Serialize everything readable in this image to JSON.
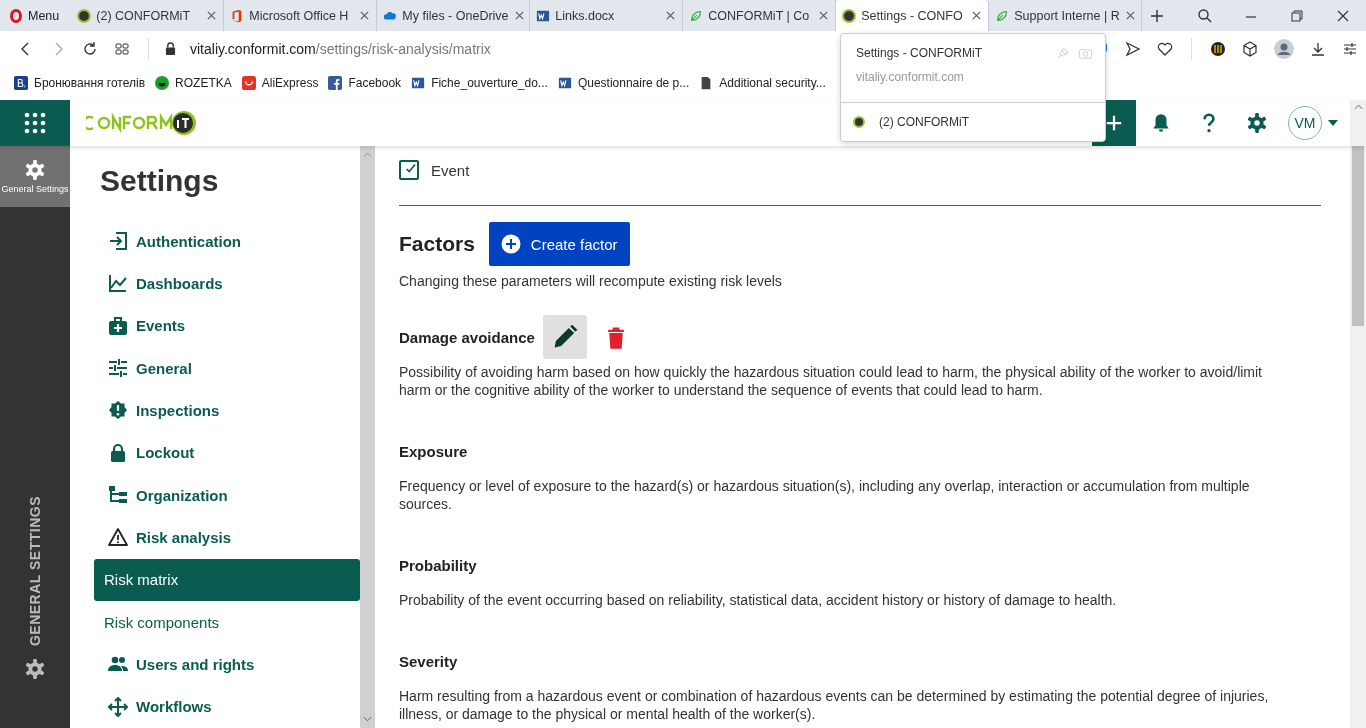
{
  "browser": {
    "menu": "Menu",
    "tabs": [
      {
        "title": "(2) CONFORMiT",
        "kind": "conformit",
        "selected": false
      },
      {
        "title": "Microsoft Office H",
        "kind": "office",
        "selected": false
      },
      {
        "title": "My files - OneDrive",
        "kind": "onedrive",
        "selected": false
      },
      {
        "title": "Links.docx",
        "kind": "word",
        "selected": false
      },
      {
        "title": "CONFORMiT | Co",
        "kind": "leaf",
        "selected": false
      },
      {
        "title": "Settings - CONFO",
        "kind": "conformit",
        "selected": true
      },
      {
        "title": "Support Interne | R",
        "kind": "leaf",
        "selected": false
      }
    ],
    "address": {
      "host": "vitaliy.conformit.com",
      "path": "/settings/risk-analysis/matrix"
    },
    "bookmarks": [
      {
        "label": "Бронювання готелів",
        "kind": "booking"
      },
      {
        "label": "ROZETKA",
        "kind": "rozetka"
      },
      {
        "label": "AliExpress",
        "kind": "ali"
      },
      {
        "label": "Facebook",
        "kind": "facebook"
      },
      {
        "label": "Fiche_ouverture_do...",
        "kind": "word"
      },
      {
        "label": "Questionnaire de p...",
        "kind": "word"
      },
      {
        "label": "Additional security...",
        "kind": "file"
      }
    ],
    "tab_preview": {
      "title": "Settings - CONFORMiT",
      "url": "vitaliy.conformit.com",
      "other": "(2) CONFORMiT"
    }
  },
  "header": {
    "avatar": "VM"
  },
  "rail": {
    "items": [
      {
        "label": "General Settings",
        "selected": true
      }
    ],
    "section": "GENERAL SETTINGS"
  },
  "sidebar": {
    "title": "Settings",
    "items": [
      {
        "label": "Authentication",
        "selected": false
      },
      {
        "label": "Dashboards",
        "selected": false
      },
      {
        "label": "Events",
        "selected": false
      },
      {
        "label": "General",
        "selected": false
      },
      {
        "label": "Inspections",
        "selected": false
      },
      {
        "label": "Lockout",
        "selected": false
      },
      {
        "label": "Organization",
        "selected": false
      },
      {
        "label": "Risk analysis",
        "selected": false,
        "children": [
          {
            "label": "Risk matrix",
            "selected": true
          },
          {
            "label": "Risk components",
            "selected": false
          }
        ]
      },
      {
        "label": "Users and rights",
        "selected": false
      },
      {
        "label": "Workflows",
        "selected": false
      }
    ]
  },
  "main": {
    "checkbox": {
      "label": "Event",
      "checked": true
    },
    "factors_title": "Factors",
    "create_button": "Create factor",
    "note": "Changing these parameters will recompute existing risk levels",
    "factors": [
      {
        "name": "Damage avoidance",
        "hovered": true,
        "description": "Possibility of avoiding harm based on how quickly the hazardous situation could lead to harm, the physical ability of the worker to avoid/limit harm or the cognitive ability of the worker to understand the sequence of events that could lead to harm."
      },
      {
        "name": "Exposure",
        "hovered": false,
        "description": "Frequency or level of exposure to the hazard(s) or hazardous situation(s), including any overlap, interaction or accumulation from multiple sources."
      },
      {
        "name": "Probability",
        "hovered": false,
        "description": "Probability of the event occurring based on reliability, statistical data, accident history or history of damage to health."
      },
      {
        "name": "Severity",
        "hovered": false,
        "description": "Harm resulting from a hazardous event or combination of hazardous events can be determined by estimating the potential degree of injuries, illness, or damage to the physical or mental health of the worker(s)."
      }
    ]
  }
}
